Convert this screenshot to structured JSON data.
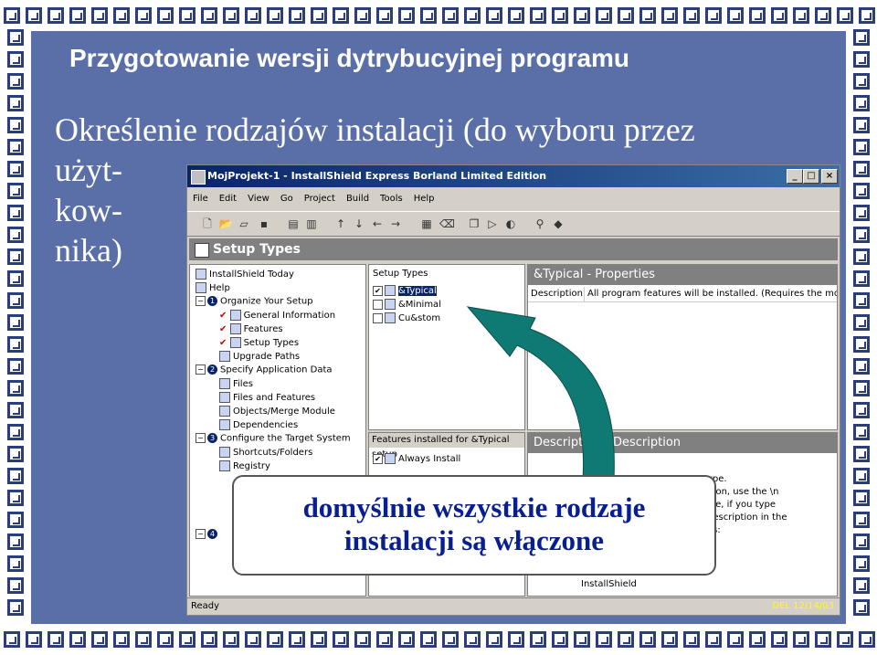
{
  "slide": {
    "title": "Przygotowanie wersji dytrybucyjnej programu",
    "subtitle_line1": "Określenie rodzajów instalacji (do wyboru przez",
    "subtitle_line2": "użyt-",
    "subtitle_line3": "kow-",
    "subtitle_line4": "nika)"
  },
  "window": {
    "title": "MojProjekt-1 - InstallShield Express Borland Limited Edition",
    "min_btn": "_",
    "max_btn": "□",
    "close_btn": "×",
    "menu": [
      "File",
      "Edit",
      "View",
      "Go",
      "Project",
      "Build",
      "Tools",
      "Help"
    ],
    "section_header": "Setup Types",
    "tree": [
      {
        "label": "InstallShield Today",
        "indent": 0,
        "kind": "item"
      },
      {
        "label": "Help",
        "indent": 0,
        "kind": "item"
      },
      {
        "label": "Organize Your Setup",
        "indent": 0,
        "kind": "group",
        "num": "1"
      },
      {
        "label": "General Information",
        "indent": 1,
        "kind": "check"
      },
      {
        "label": "Features",
        "indent": 1,
        "kind": "check"
      },
      {
        "label": "Setup Types",
        "indent": 1,
        "kind": "check"
      },
      {
        "label": "Upgrade Paths",
        "indent": 1,
        "kind": "item"
      },
      {
        "label": "Specify Application Data",
        "indent": 0,
        "kind": "group",
        "num": "2"
      },
      {
        "label": "Files",
        "indent": 1,
        "kind": "item"
      },
      {
        "label": "Files and Features",
        "indent": 1,
        "kind": "item"
      },
      {
        "label": "Objects/Merge Module",
        "indent": 1,
        "kind": "item"
      },
      {
        "label": "Dependencies",
        "indent": 1,
        "kind": "item"
      },
      {
        "label": "Configure the Target System",
        "indent": 0,
        "kind": "group",
        "num": "3"
      },
      {
        "label": "Shortcuts/Folders",
        "indent": 1,
        "kind": "item"
      },
      {
        "label": "Registry",
        "indent": 1,
        "kind": "item"
      }
    ],
    "tree_group4_num": "4",
    "setup_types_header": "Setup Types",
    "setup_types": [
      {
        "label": "&Typical",
        "checked": true
      },
      {
        "label": "&Minimal",
        "checked": false
      },
      {
        "label": "Cu&stom",
        "checked": false
      }
    ],
    "properties_header": "&Typical - Properties",
    "prop_name": "Description",
    "prop_value": "All program features will be installed. (Requires the most disk",
    "features_header": "Features installed for &Typical setup",
    "feature_item": "Always Install",
    "description_header": "Description - Description",
    "desc_lines": [
      "ype.",
      "ition, use the \\n",
      "ple, if you type",
      "description in the",
      "as:"
    ],
    "desc_footer": "InstallShield",
    "status": "Ready",
    "status_right": "DEL 12/14/03"
  },
  "callout": {
    "line1": "domyślnie wszystkie rodzaje",
    "line2": "instalacji są włączone"
  },
  "colors": {
    "slide_bg": "#5a6fa8",
    "callout_text": "#0a1f8f",
    "arrow": "#0f7a73"
  }
}
